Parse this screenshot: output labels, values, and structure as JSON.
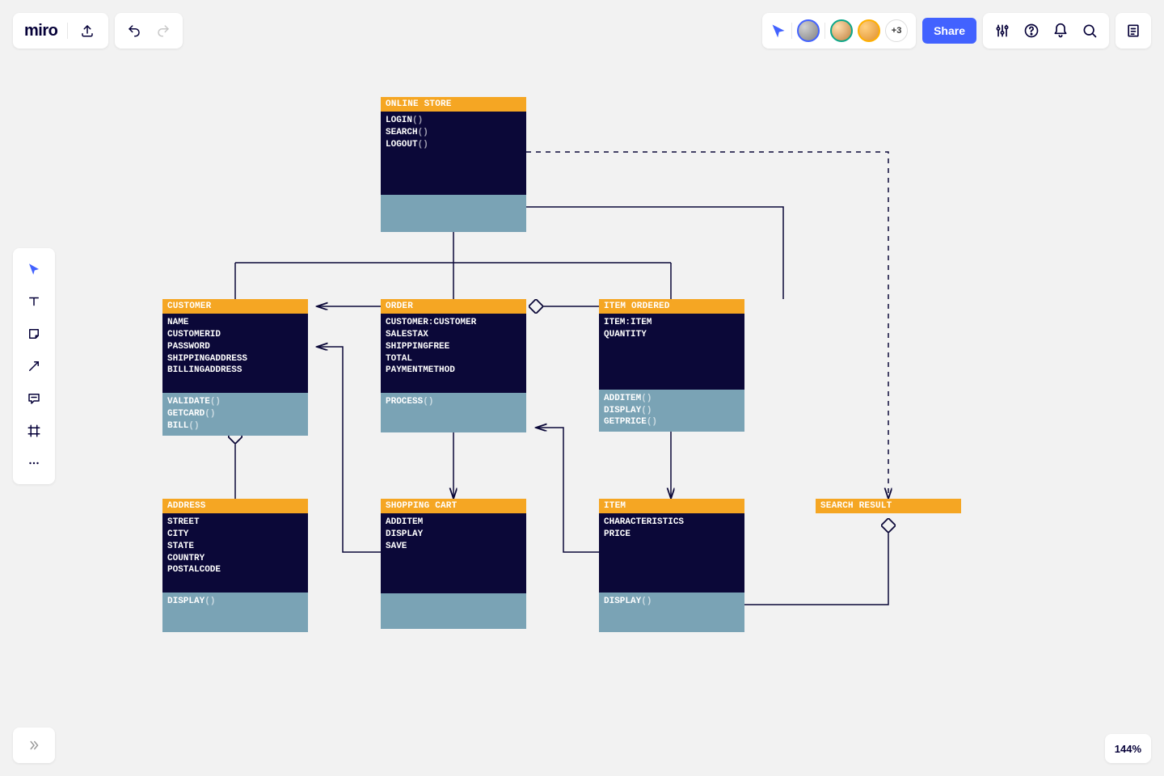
{
  "app": {
    "logo": "miro"
  },
  "collab": {
    "more": "+3"
  },
  "share": {
    "label": "Share"
  },
  "zoom": {
    "label": "144%"
  },
  "entities": {
    "online_store": {
      "title": "ONLINE STORE",
      "methods": [
        "LOGIN",
        "SEARCH",
        "LOGOUT"
      ]
    },
    "customer": {
      "title": "CUSTOMER",
      "attrs": [
        "NAME",
        "CUSTOMERID",
        "PASSWORD",
        "SHIPPINGADDRESS",
        "BILLINGADDRESS"
      ],
      "methods": [
        "VALIDATE",
        "GETCARD",
        "BILL"
      ]
    },
    "order": {
      "title": "ORDER",
      "attrs": [
        "CUSTOMER:CUSTOMER",
        "SALESTAX",
        "SHIPPINGFREE",
        "TOTAL",
        "PAYMENTMETHOD"
      ],
      "methods": [
        "PROCESS"
      ]
    },
    "item_ordered": {
      "title": "ITEM ORDERED",
      "attrs": [
        "ITEM:ITEM",
        "QUANTITY"
      ],
      "methods": [
        "ADDITEM",
        "DISPLAY",
        "GETPRICE"
      ]
    },
    "address": {
      "title": "ADDRESS",
      "attrs": [
        "STREET",
        "CITY",
        "STATE",
        "COUNTRY",
        "POSTALCODE"
      ],
      "methods": [
        "DISPLAY"
      ]
    },
    "shopping_cart": {
      "title": "SHOPPING CART",
      "attrs": [
        "ADDITEM",
        "DISPLAY",
        "SAVE"
      ]
    },
    "item": {
      "title": "ITEM",
      "attrs": [
        "CHARACTERISTICS",
        "PRICE"
      ],
      "methods": [
        "DISPLAY"
      ]
    },
    "search_result": {
      "title": "SEARCH RESULT"
    }
  }
}
